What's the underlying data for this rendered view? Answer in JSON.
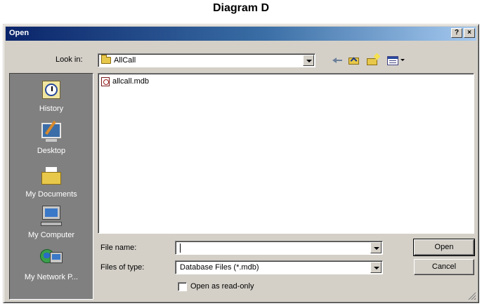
{
  "caption": "Diagram D",
  "dialog": {
    "title": "Open",
    "help_button": "?",
    "close_button": "×"
  },
  "look_in": {
    "label": "Look in:",
    "value": "AllCall"
  },
  "toolbar": {
    "icons": [
      "back-arrow-icon",
      "up-one-level-icon",
      "new-folder-icon",
      "view-menu-icon"
    ]
  },
  "places": [
    {
      "label": "History",
      "icon": "history-icon"
    },
    {
      "label": "Desktop",
      "icon": "desktop-icon"
    },
    {
      "label": "My Documents",
      "icon": "my-documents-icon"
    },
    {
      "label": "My Computer",
      "icon": "my-computer-icon"
    },
    {
      "label": "My Network P...",
      "icon": "network-places-icon"
    }
  ],
  "files": [
    {
      "name": "allcall.mdb",
      "icon": "access-database-icon"
    }
  ],
  "file_name": {
    "label": "File name:",
    "value": ""
  },
  "file_type": {
    "label": "Files of type:",
    "value": "Database Files (*.mdb)"
  },
  "buttons": {
    "open": "Open",
    "cancel": "Cancel"
  },
  "read_only": {
    "label": "Open as read-only",
    "checked": false
  },
  "colors": {
    "title_gradient_start": "#0a246a",
    "title_gradient_end": "#a6caf0",
    "dialog_face": "#d4d0c8",
    "places_bar": "#808080"
  }
}
